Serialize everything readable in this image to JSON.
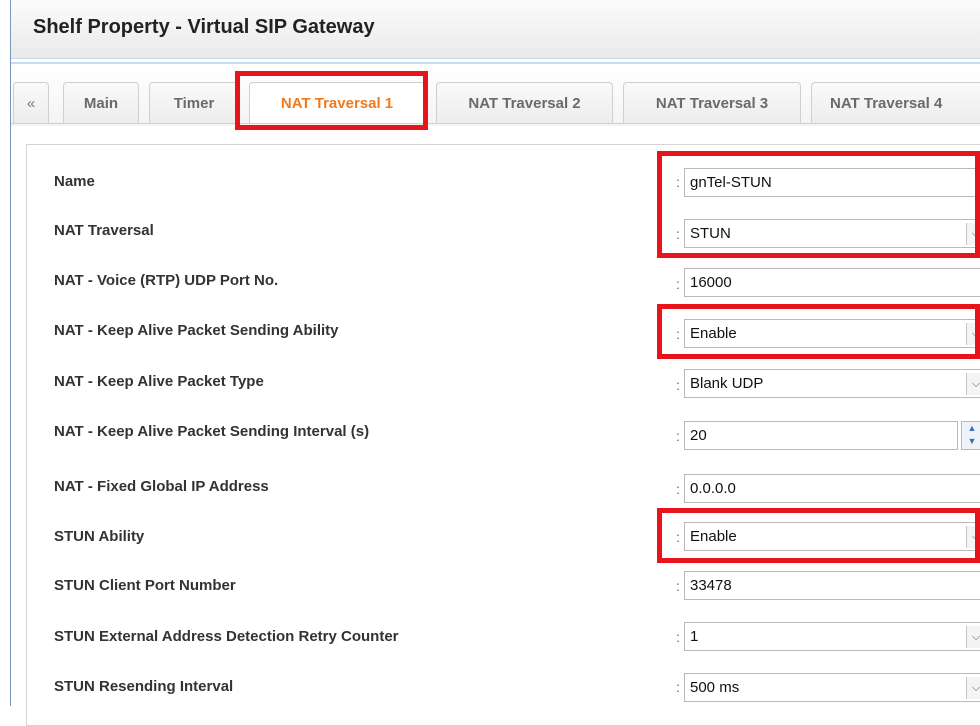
{
  "window": {
    "title": "Shelf Property - Virtual SIP Gateway"
  },
  "tabs": {
    "scroll_left": "«",
    "items": [
      "Main",
      "Timer",
      "NAT Traversal 1",
      "NAT Traversal 2",
      "NAT Traversal 3",
      "NAT Traversal 4"
    ],
    "active": "NAT Traversal 1"
  },
  "colors": {
    "active_tab": "#f07a1e",
    "highlight": "#e8141c"
  },
  "form": {
    "colon": ":",
    "rows": [
      {
        "label": "Name",
        "type": "text",
        "value": "gnTel-STUN"
      },
      {
        "label": "NAT Traversal",
        "type": "select",
        "value": "STUN"
      },
      {
        "label": "NAT - Voice (RTP) UDP Port No.",
        "type": "text",
        "value": "16000"
      },
      {
        "label": "NAT - Keep Alive Packet Sending Ability",
        "type": "select",
        "value": "Enable"
      },
      {
        "label": "NAT - Keep Alive Packet Type",
        "type": "select",
        "value": "Blank UDP"
      },
      {
        "label": "NAT - Keep Alive Packet Sending Interval (s)",
        "type": "spinner",
        "value": "20"
      },
      {
        "label": "NAT - Fixed Global IP Address",
        "type": "text",
        "value": "0.0.0.0"
      },
      {
        "label": "STUN Ability",
        "type": "select",
        "value": "Enable"
      },
      {
        "label": "STUN Client Port Number",
        "type": "text",
        "value": "33478"
      },
      {
        "label": "STUN External Address Detection Retry Counter",
        "type": "select",
        "value": "1"
      },
      {
        "label": "STUN Resending Interval",
        "type": "select",
        "value": "500 ms"
      }
    ]
  },
  "icons": {
    "select_arrow": "chevron-down-icon",
    "spinner": "spinner-arrows-icon"
  }
}
